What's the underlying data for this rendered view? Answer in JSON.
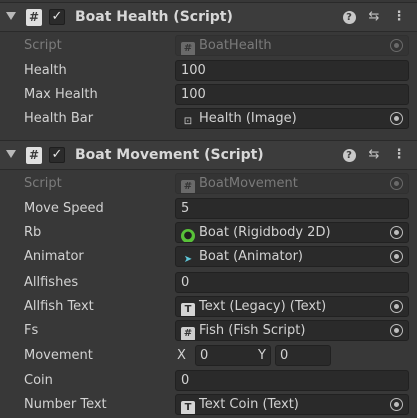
{
  "boat_health": {
    "title": "Boat Health (Script)",
    "icon": "script-icon",
    "enabled": true,
    "fields": {
      "script": {
        "label": "Script",
        "value": "BoatHealth"
      },
      "health": {
        "label": "Health",
        "value": "100"
      },
      "max_health": {
        "label": "Max Health",
        "value": "100"
      },
      "health_bar": {
        "label": "Health Bar",
        "value": "Health (Image)"
      }
    }
  },
  "boat_movement": {
    "title": "Boat Movement (Script)",
    "icon": "script-icon",
    "enabled": true,
    "fields": {
      "script": {
        "label": "Script",
        "value": "BoatMovement"
      },
      "move_speed": {
        "label": "Move Speed",
        "value": "5"
      },
      "rb": {
        "label": "Rb",
        "value": "Boat (Rigidbody 2D)"
      },
      "animator": {
        "label": "Animator",
        "value": "Boat (Animator)"
      },
      "allfishes": {
        "label": "Allfishes",
        "value": "0"
      },
      "allfish_text": {
        "label": "Allfish Text",
        "value": "Text (Legacy) (Text)"
      },
      "fs": {
        "label": "Fs",
        "value": "Fish (Fish Script)"
      },
      "movement": {
        "label": "Movement",
        "x_label": "X",
        "x_value": "0",
        "y_label": "Y",
        "y_value": "0"
      },
      "coin": {
        "label": "Coin",
        "value": "0"
      },
      "number_text": {
        "label": "Number Text",
        "value": "Text Coin (Text)"
      }
    }
  },
  "header_icons": {
    "help": "?",
    "preset": "⇆",
    "menu": "⋮"
  },
  "colors": {
    "background": "#383838",
    "field_bg": "#2a2a2a",
    "rigidbody_icon": "#58c239",
    "animator_icon": "#5ec6d8"
  }
}
